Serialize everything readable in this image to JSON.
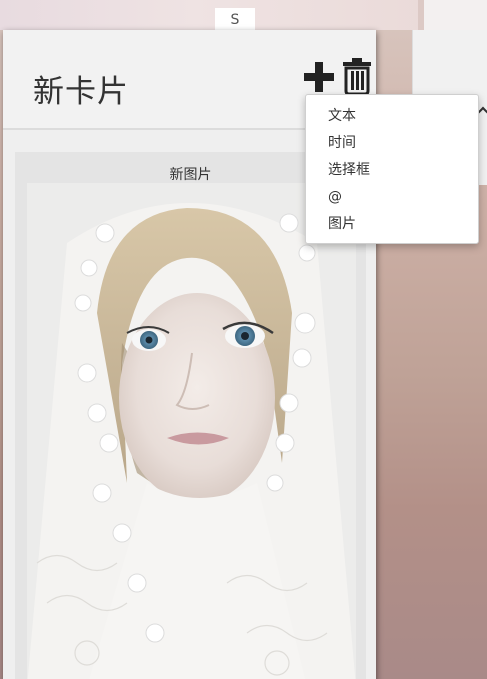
{
  "background": {
    "tile_glyph": "S"
  },
  "card": {
    "title": "新卡片",
    "add_icon": "plus-icon",
    "delete_icon": "trash-icon",
    "image_block": {
      "label": "新图片"
    }
  },
  "add_menu": {
    "items": [
      {
        "label": "文本"
      },
      {
        "label": "时间"
      },
      {
        "label": "选择框"
      },
      {
        "label": "@"
      },
      {
        "label": "图片"
      }
    ]
  }
}
